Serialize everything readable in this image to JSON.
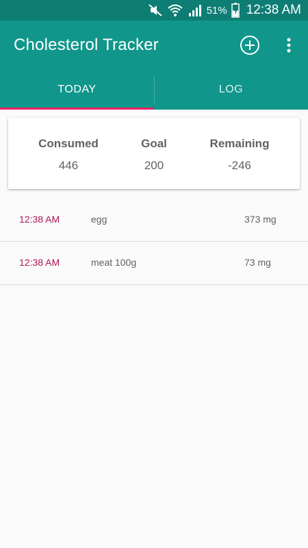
{
  "status_bar": {
    "battery_percent": "51%",
    "time": "12:38 AM",
    "icons": [
      "mute-icon",
      "wifi-icon",
      "signal-icon",
      "battery-charging-icon"
    ]
  },
  "app_bar": {
    "title": "Cholesterol Tracker",
    "add_icon": "add-circle-icon",
    "more_icon": "more-vert-icon"
  },
  "tabs": [
    {
      "label": "TODAY",
      "active": true
    },
    {
      "label": "LOG",
      "active": false
    }
  ],
  "summary": {
    "consumed_label": "Consumed",
    "consumed_value": "446",
    "goal_label": "Goal",
    "goal_value": "200",
    "remaining_label": "Remaining",
    "remaining_value": "-246"
  },
  "entries": [
    {
      "time": "12:38 AM",
      "food": "egg",
      "amount": "373 mg"
    },
    {
      "time": "12:38 AM",
      "food": "meat 100g",
      "amount": "73 mg"
    }
  ],
  "colors": {
    "primary": "#11968b",
    "primary_dark": "#0e7d74",
    "accent": "#e91e63",
    "time_text": "#ad1457"
  }
}
